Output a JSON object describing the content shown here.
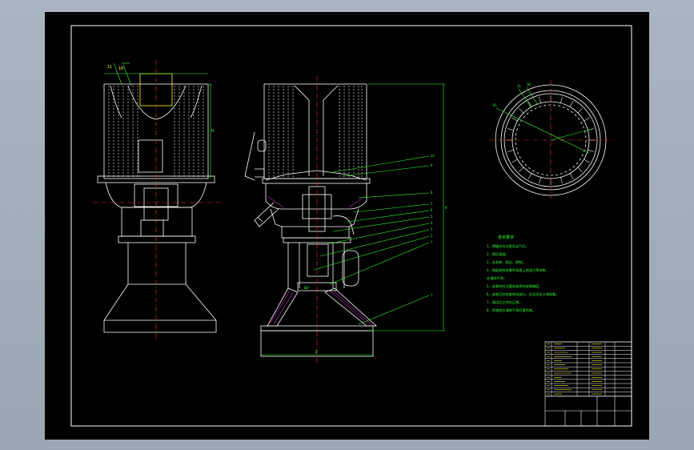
{
  "drawing": {
    "background": "#000000",
    "frame_color": "#ffffff",
    "outline_color": "#ffffff",
    "centerline_color": "#ff3333",
    "dimension_color": "#33ff33",
    "cyan": "#33ffff",
    "magenta": "#ff44ff",
    "yellow": "#ffff33"
  },
  "notes": {
    "title": "技术要求",
    "items": [
      "1、焊缝应均匀密实无气孔；",
      "2、焊后清渣；",
      "3、去毛刺、锐边、倒钝；",
      "4、装配前所有零件表面上的油污等杂物",
      "应清除干净；",
      "5、安装时应注意各部件的安装精度；",
      "6、安装后应检查转动部分，应灵活无卡滞现象；",
      "7、调试后工作应正常；",
      "8、喷漆前应清除干净后再喷漆。"
    ]
  }
}
